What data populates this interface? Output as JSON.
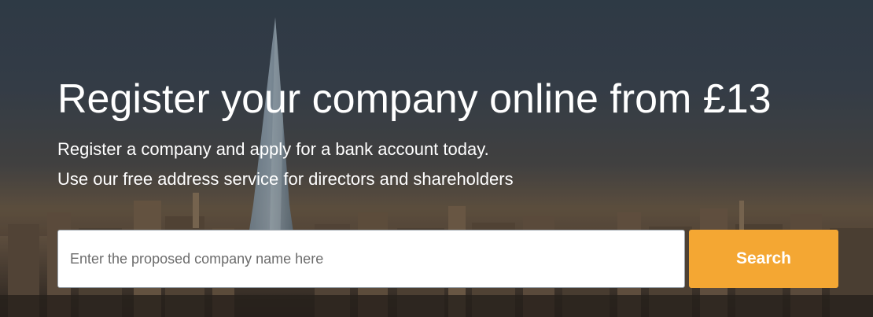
{
  "hero": {
    "headline": "Register your company online from £13",
    "subtext_line1": "Register a company and apply for a bank account today.",
    "subtext_line2": "Use our free address service for directors and shareholders"
  },
  "search": {
    "placeholder": "Enter the proposed company name here",
    "value": "",
    "button_label": "Search"
  },
  "colors": {
    "accent": "#f4a733",
    "text": "#ffffff"
  }
}
